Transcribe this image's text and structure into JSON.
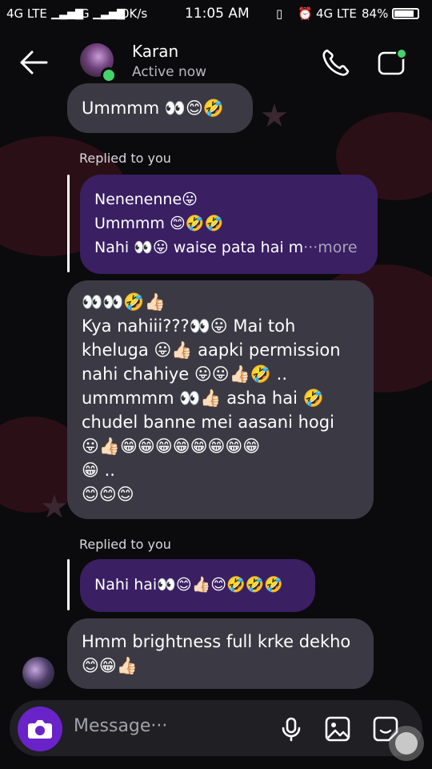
{
  "statusbar": {
    "net1": "4G LTE",
    "net2": "G",
    "speed": "0K/s",
    "time": "11:05 AM",
    "net3": "4G LTE",
    "battery": "84%",
    "battery_level": 0.84
  },
  "header": {
    "name": "Karan",
    "status": "Active now"
  },
  "messages": {
    "m1": "Ummmm 👀😊🤣",
    "reply1_label": "Replied to you",
    "reply1_line1": "Nenenenne😛",
    "reply1_line2": "Ummmm 😊🤣🤣",
    "reply1_line3": "Nahi 👀😛 waise pata hai m",
    "reply1_more": "···more",
    "m2_line1": "👀👀🤣👍🏻",
    "m2_line2": "Kya nahiii???👀😛 Mai toh",
    "m2_line3": "kheluga 😛👍🏻 aapki permission",
    "m2_line4": "nahi chahiye 😛😛👍🏻🤣 ..",
    "m2_line5": "ummmmm 👀👍🏻 asha hai 🤣",
    "m2_line6": "chudel banne mei aasani hogi",
    "m2_line7": "😛👍🏻😁😁😁😁😁😁😁😁",
    "m2_line8": "😁 ..",
    "m2_line9": "😊😊😊",
    "reply2_label": "Replied to you",
    "reply2_text": "Nahi hai👀😊👍🏻😊🤣🤣🤣",
    "m3_line1": "Hmm brightness full krke dekho",
    "m3_line2": "😊😁👍🏻"
  },
  "composer": {
    "placeholder": "Message···"
  },
  "icons": {
    "back": "back-arrow-icon",
    "call": "phone-icon",
    "video": "video-camera-icon",
    "camera": "camera-icon",
    "mic": "microphone-icon",
    "gallery": "image-icon",
    "sticker": "sticker-icon"
  },
  "colors": {
    "accent_purple": "#6a22c9",
    "bubble_gray": "#3b3a44",
    "bubble_purple": "#3a1f63",
    "online_green": "#44d36b"
  }
}
